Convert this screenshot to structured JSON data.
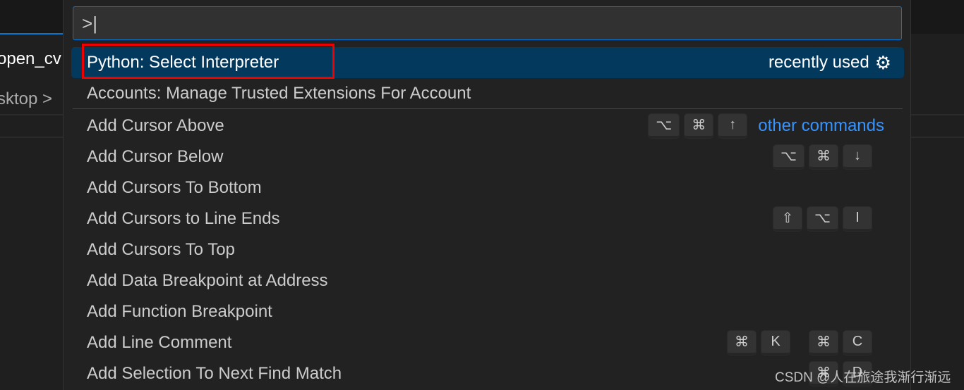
{
  "background": {
    "tab_label": "open_cv",
    "breadcrumb": "sktop",
    "breadcrumb_sep": ">"
  },
  "palette": {
    "input_value": ">",
    "selected": {
      "label": "Python: Select Interpreter",
      "note": "recently used",
      "icon": "gear-icon"
    },
    "recent": [
      {
        "label": "Accounts: Manage Trusted Extensions For Account"
      }
    ],
    "other_label": "other commands",
    "items": [
      {
        "label": "Add Cursor Above",
        "keys": [
          [
            "⌥",
            "⌘",
            "↑"
          ]
        ]
      },
      {
        "label": "Add Cursor Below",
        "keys": [
          [
            "⌥",
            "⌘",
            "↓"
          ]
        ]
      },
      {
        "label": "Add Cursors To Bottom",
        "keys": []
      },
      {
        "label": "Add Cursors to Line Ends",
        "keys": [
          [
            "⇧",
            "⌥",
            "I"
          ]
        ]
      },
      {
        "label": "Add Cursors To Top",
        "keys": []
      },
      {
        "label": "Add Data Breakpoint at Address",
        "keys": []
      },
      {
        "label": "Add Function Breakpoint",
        "keys": []
      },
      {
        "label": "Add Line Comment",
        "keys": [
          [
            "⌘",
            "K"
          ],
          [
            "⌘",
            "C"
          ]
        ]
      },
      {
        "label": "Add Selection To Next Find Match",
        "keys": [
          [
            "⌘",
            "D"
          ]
        ]
      }
    ]
  },
  "watermark": "CSDN @人在旅途我渐行渐远",
  "colors": {
    "accent": "#0078d4",
    "selection": "#04395e",
    "link": "#3794ff",
    "highlight_box": "#f00000"
  }
}
